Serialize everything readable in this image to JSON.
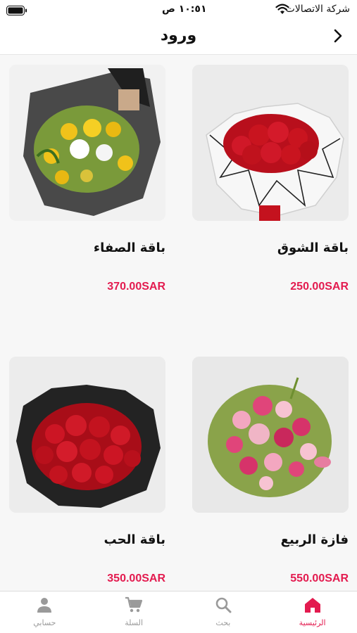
{
  "status_bar": {
    "carrier": "شركة الاتصالات",
    "time": "١٠:٥١ ص"
  },
  "nav": {
    "title": "ورود",
    "back_icon": "chevron-right-icon"
  },
  "products": [
    {
      "name": "باقة الشوق",
      "price": "250.00SAR",
      "image": "red-roses-white-wrap"
    },
    {
      "name": "باقة الصفاء",
      "price": "370.00SAR",
      "image": "yellow-roses-black-wrap"
    },
    {
      "name": "فازة الربيع",
      "price": "550.00SAR",
      "image": "pink-spring-vase"
    },
    {
      "name": "باقة الحب",
      "price": "350.00SAR",
      "image": "red-roses-black-wrap"
    }
  ],
  "tabs": [
    {
      "label": "الرئيسية",
      "icon": "home-icon",
      "active": true
    },
    {
      "label": "بحث",
      "icon": "search-icon",
      "active": false
    },
    {
      "label": "السلة",
      "icon": "cart-icon",
      "active": false
    },
    {
      "label": "حسابي",
      "icon": "user-icon",
      "active": false
    }
  ],
  "colors": {
    "accent": "#e31b4f",
    "tab_inactive": "#9a9a9a",
    "background": "#f7f7f7"
  }
}
